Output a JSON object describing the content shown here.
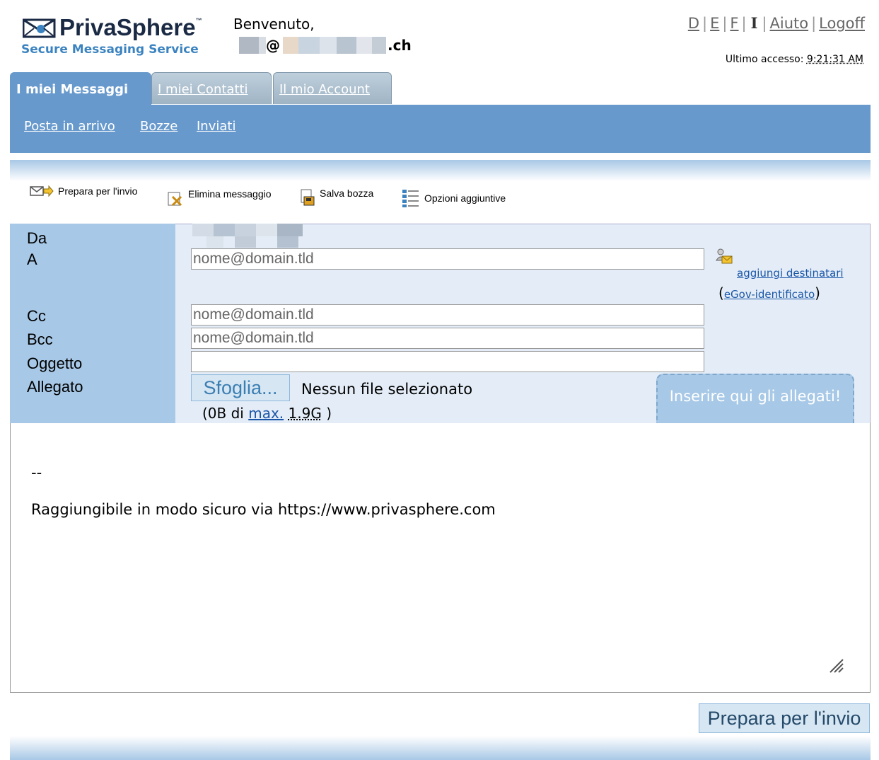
{
  "header": {
    "brand": "PrivaSphere",
    "trademark": "™",
    "tagline": "Secure Messaging Service",
    "welcome": "Benvenuto,",
    "email_at": "@",
    "email_domain_suffix": ".ch",
    "languages": [
      "D",
      "E",
      "F",
      "I"
    ],
    "current_language": "I",
    "help": "Aiuto",
    "logoff": "Logoff",
    "last_access_label": "Ultimo accesso:",
    "last_access_time": "9:21:31 AM"
  },
  "tabs": [
    {
      "label": "I miei Messaggi",
      "active": true
    },
    {
      "label": "I miei Contatti",
      "active": false
    },
    {
      "label": "Il mio Account",
      "active": false
    }
  ],
  "subnav": [
    "Posta in arrivo",
    "Bozze",
    "Inviati"
  ],
  "toolbar": {
    "send": "Prepara per l'invio",
    "delete": "Elimina messaggio",
    "save": "Salva bozza",
    "options": "Opzioni aggiuntive"
  },
  "form": {
    "labels": {
      "from": "Da",
      "to": "A",
      "cc": "Cc",
      "bcc": "Bcc",
      "subject": "Oggetto",
      "attachment": "Allegato"
    },
    "to_placeholder": "nome@domain.tld",
    "cc_placeholder": "nome@domain.tld",
    "bcc_placeholder": "nome@domain.tld",
    "subject_value": "",
    "add_recipients": "aggiungi destinatari",
    "egov_link": "eGov-identificato",
    "browse_button": "Sfoglia...",
    "no_file": "Nessun file selezionato",
    "quota_prefix": "(0B di",
    "quota_link": "max.",
    "quota_value": "1.9G",
    "quota_suffix": ")",
    "drop_zone": "Inserire qui gli allegati!"
  },
  "body": {
    "signature_dash": "--",
    "signature_text": "Raggiungibile in modo sicuro via https://www.privasphere.com"
  },
  "submit": "Prepara per l'invio",
  "colors": {
    "primary": "#6799cc",
    "label_col": "#a7c8e6",
    "form_bg": "#e4edf7",
    "link": "#1a56a8"
  }
}
